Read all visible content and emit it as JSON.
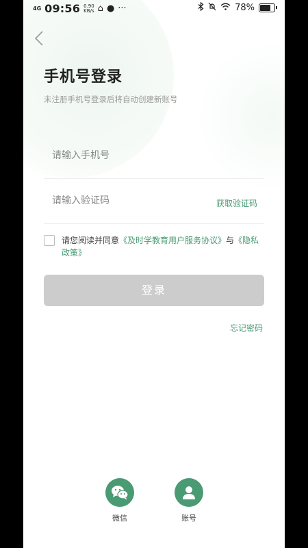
{
  "statusbar": {
    "signal": "4G",
    "time": "09:56",
    "speed_value": "0.90",
    "speed_unit": "KB/s",
    "more": "···",
    "battery": "78%",
    "battery_level": 0.78
  },
  "header": {
    "title": "手机号登录",
    "subtitle": "未注册手机号登录后将自动创建新账号"
  },
  "form": {
    "phone_placeholder": "请输入手机号",
    "code_placeholder": "请输入验证码",
    "get_code_label": "获取验证码"
  },
  "agreement": {
    "prefix": "请您阅读并同意",
    "service_link": "《及时学教育用户服务协议》",
    "connector": "与",
    "privacy_link": "《隐私政策》"
  },
  "actions": {
    "login_label": "登录",
    "forgot_label": "忘记密码"
  },
  "social": {
    "wechat_label": "微信",
    "account_label": "账号"
  },
  "colors": {
    "accent": "#4a9a74",
    "disabled_button": "#cccccc"
  }
}
